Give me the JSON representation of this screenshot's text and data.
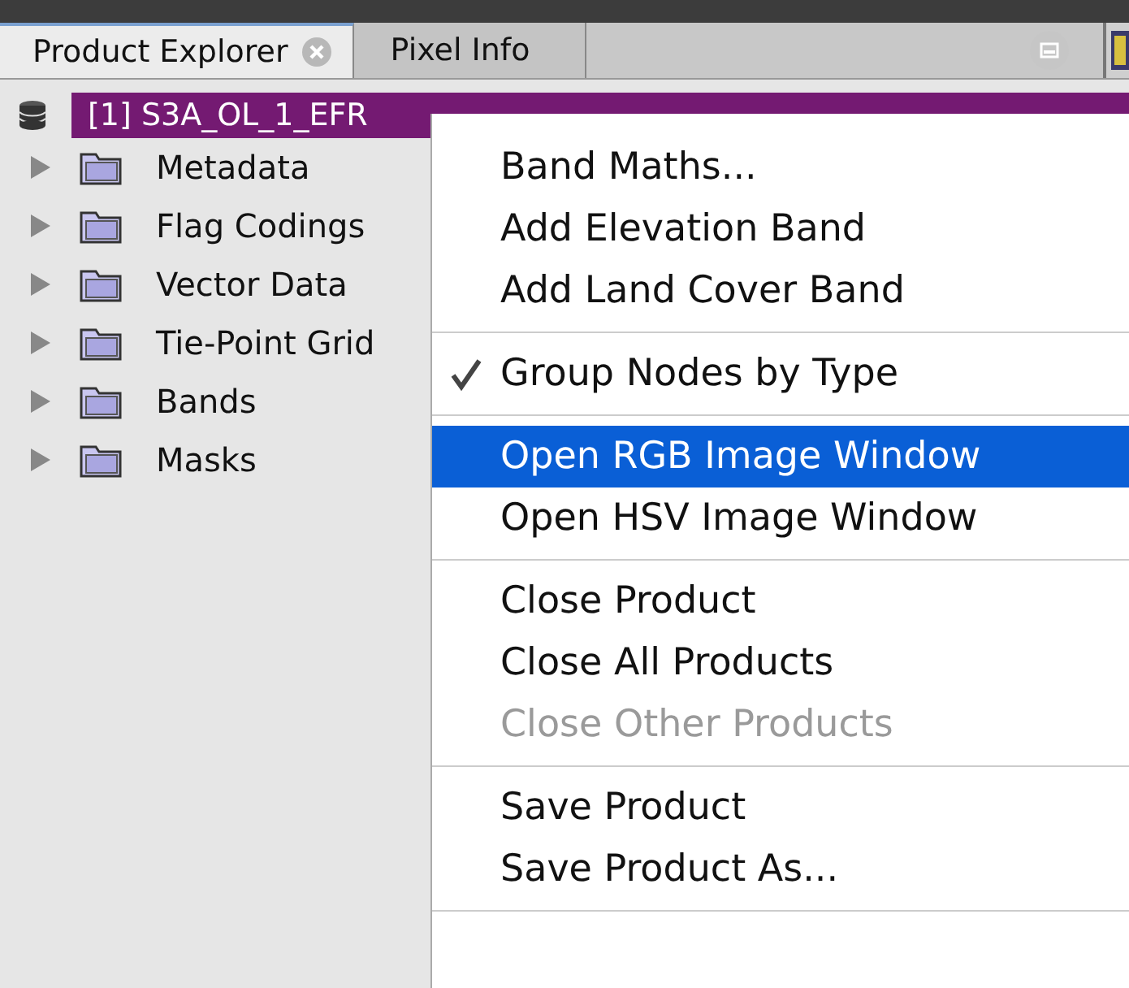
{
  "tabs": [
    {
      "label": "Product Explorer",
      "selected": true,
      "closable": true
    },
    {
      "label": "Pixel Info",
      "selected": false,
      "closable": false
    }
  ],
  "tree": {
    "label": "[1] S3A_OL_1_EFR",
    "selected": true,
    "children": [
      {
        "label": "Metadata",
        "expanded": false
      },
      {
        "label": "Flag Codings",
        "expanded": false
      },
      {
        "label": "Vector Data",
        "expanded": false
      },
      {
        "label": "Tie-Point Grid",
        "expanded": false
      },
      {
        "label": "Bands",
        "expanded": false
      },
      {
        "label": "Masks",
        "expanded": false
      }
    ]
  },
  "context_menu": {
    "groups": [
      [
        {
          "label": "Band Maths...",
          "checked": false,
          "selected": false,
          "disabled": false
        },
        {
          "label": "Add Elevation Band",
          "checked": false,
          "selected": false,
          "disabled": false
        },
        {
          "label": "Add Land Cover Band",
          "checked": false,
          "selected": false,
          "disabled": false
        }
      ],
      [
        {
          "label": "Group Nodes by Type",
          "checked": true,
          "selected": false,
          "disabled": false
        }
      ],
      [
        {
          "label": "Open RGB Image Window",
          "checked": false,
          "selected": true,
          "disabled": false
        },
        {
          "label": "Open HSV Image Window",
          "checked": false,
          "selected": false,
          "disabled": false
        }
      ],
      [
        {
          "label": "Close Product",
          "checked": false,
          "selected": false,
          "disabled": false
        },
        {
          "label": "Close All Products",
          "checked": false,
          "selected": false,
          "disabled": false
        },
        {
          "label": "Close Other Products",
          "checked": false,
          "selected": false,
          "disabled": true
        }
      ],
      [
        {
          "label": "Save Product",
          "checked": false,
          "selected": false,
          "disabled": false
        },
        {
          "label": "Save Product As...",
          "checked": false,
          "selected": false,
          "disabled": false
        }
      ]
    ]
  }
}
